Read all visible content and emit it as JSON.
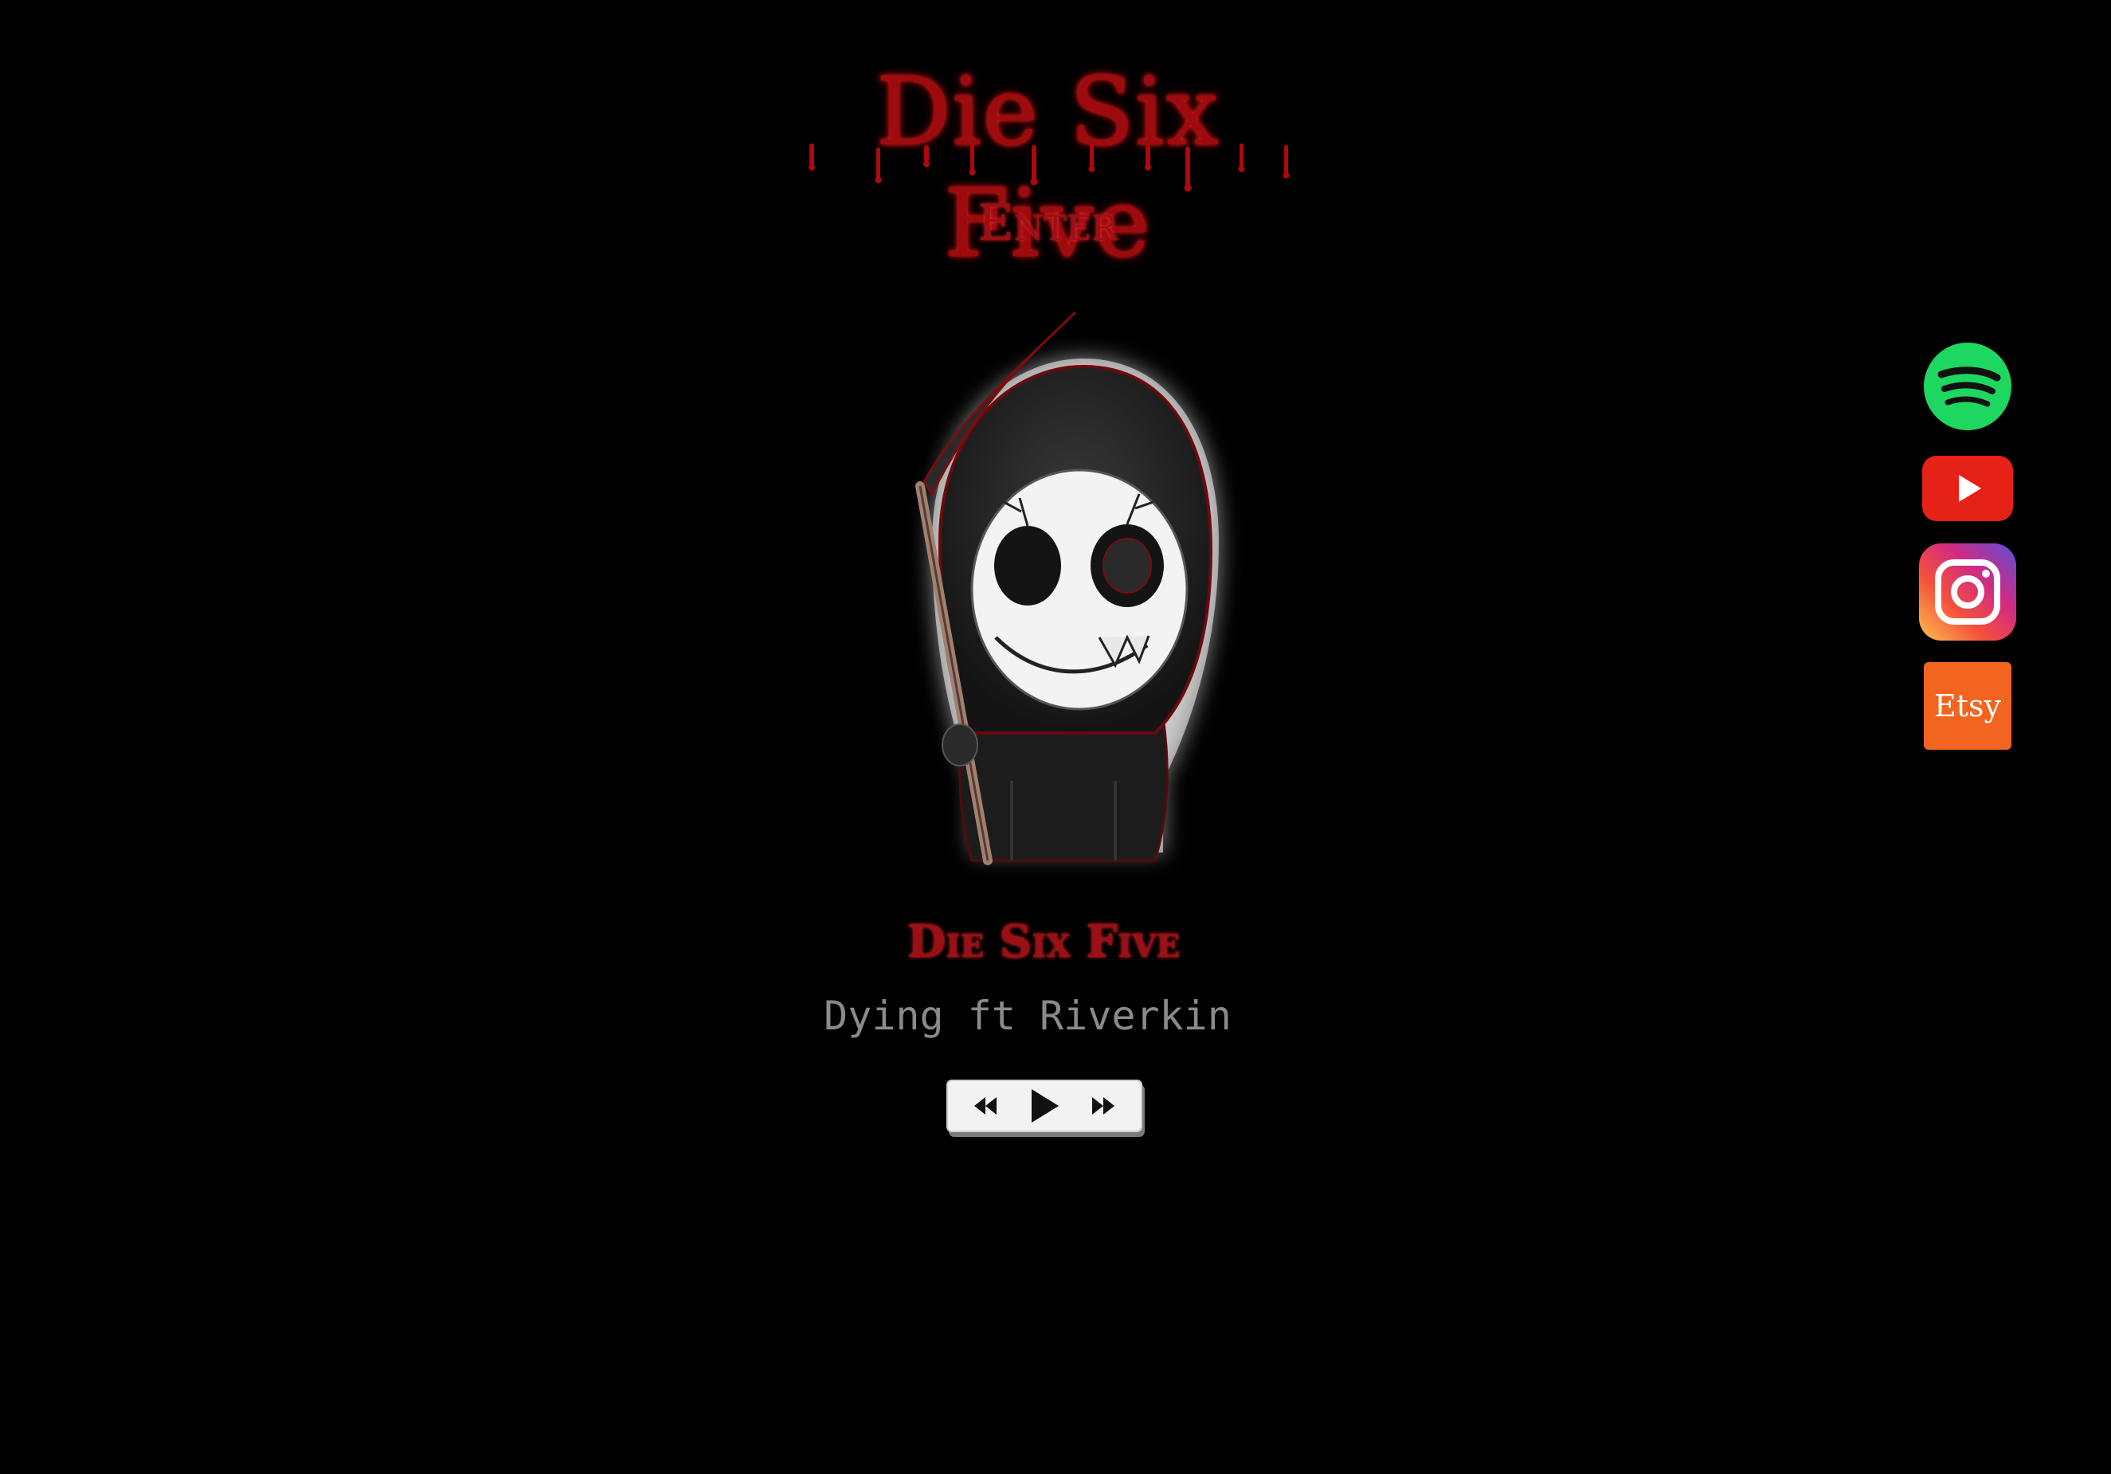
{
  "header": {
    "logo_text": "Die Six Five",
    "enter_label": "Enter"
  },
  "player": {
    "artist": "Die Six Five",
    "track": "Dying ft Riverkin",
    "controls": {
      "rewind_icon": "rewind-icon",
      "play_icon": "play-icon",
      "forward_icon": "fast-forward-icon"
    }
  },
  "social_links": {
    "spotify_icon": "spotify-icon",
    "youtube_icon": "youtube-icon",
    "instagram_icon": "instagram-icon",
    "etsy_label": "Etsy"
  },
  "colors": {
    "background": "#000000",
    "accent_red": "#9a1016",
    "spotify": "#1ed760",
    "youtube": "#e62117",
    "etsy": "#f16521"
  }
}
